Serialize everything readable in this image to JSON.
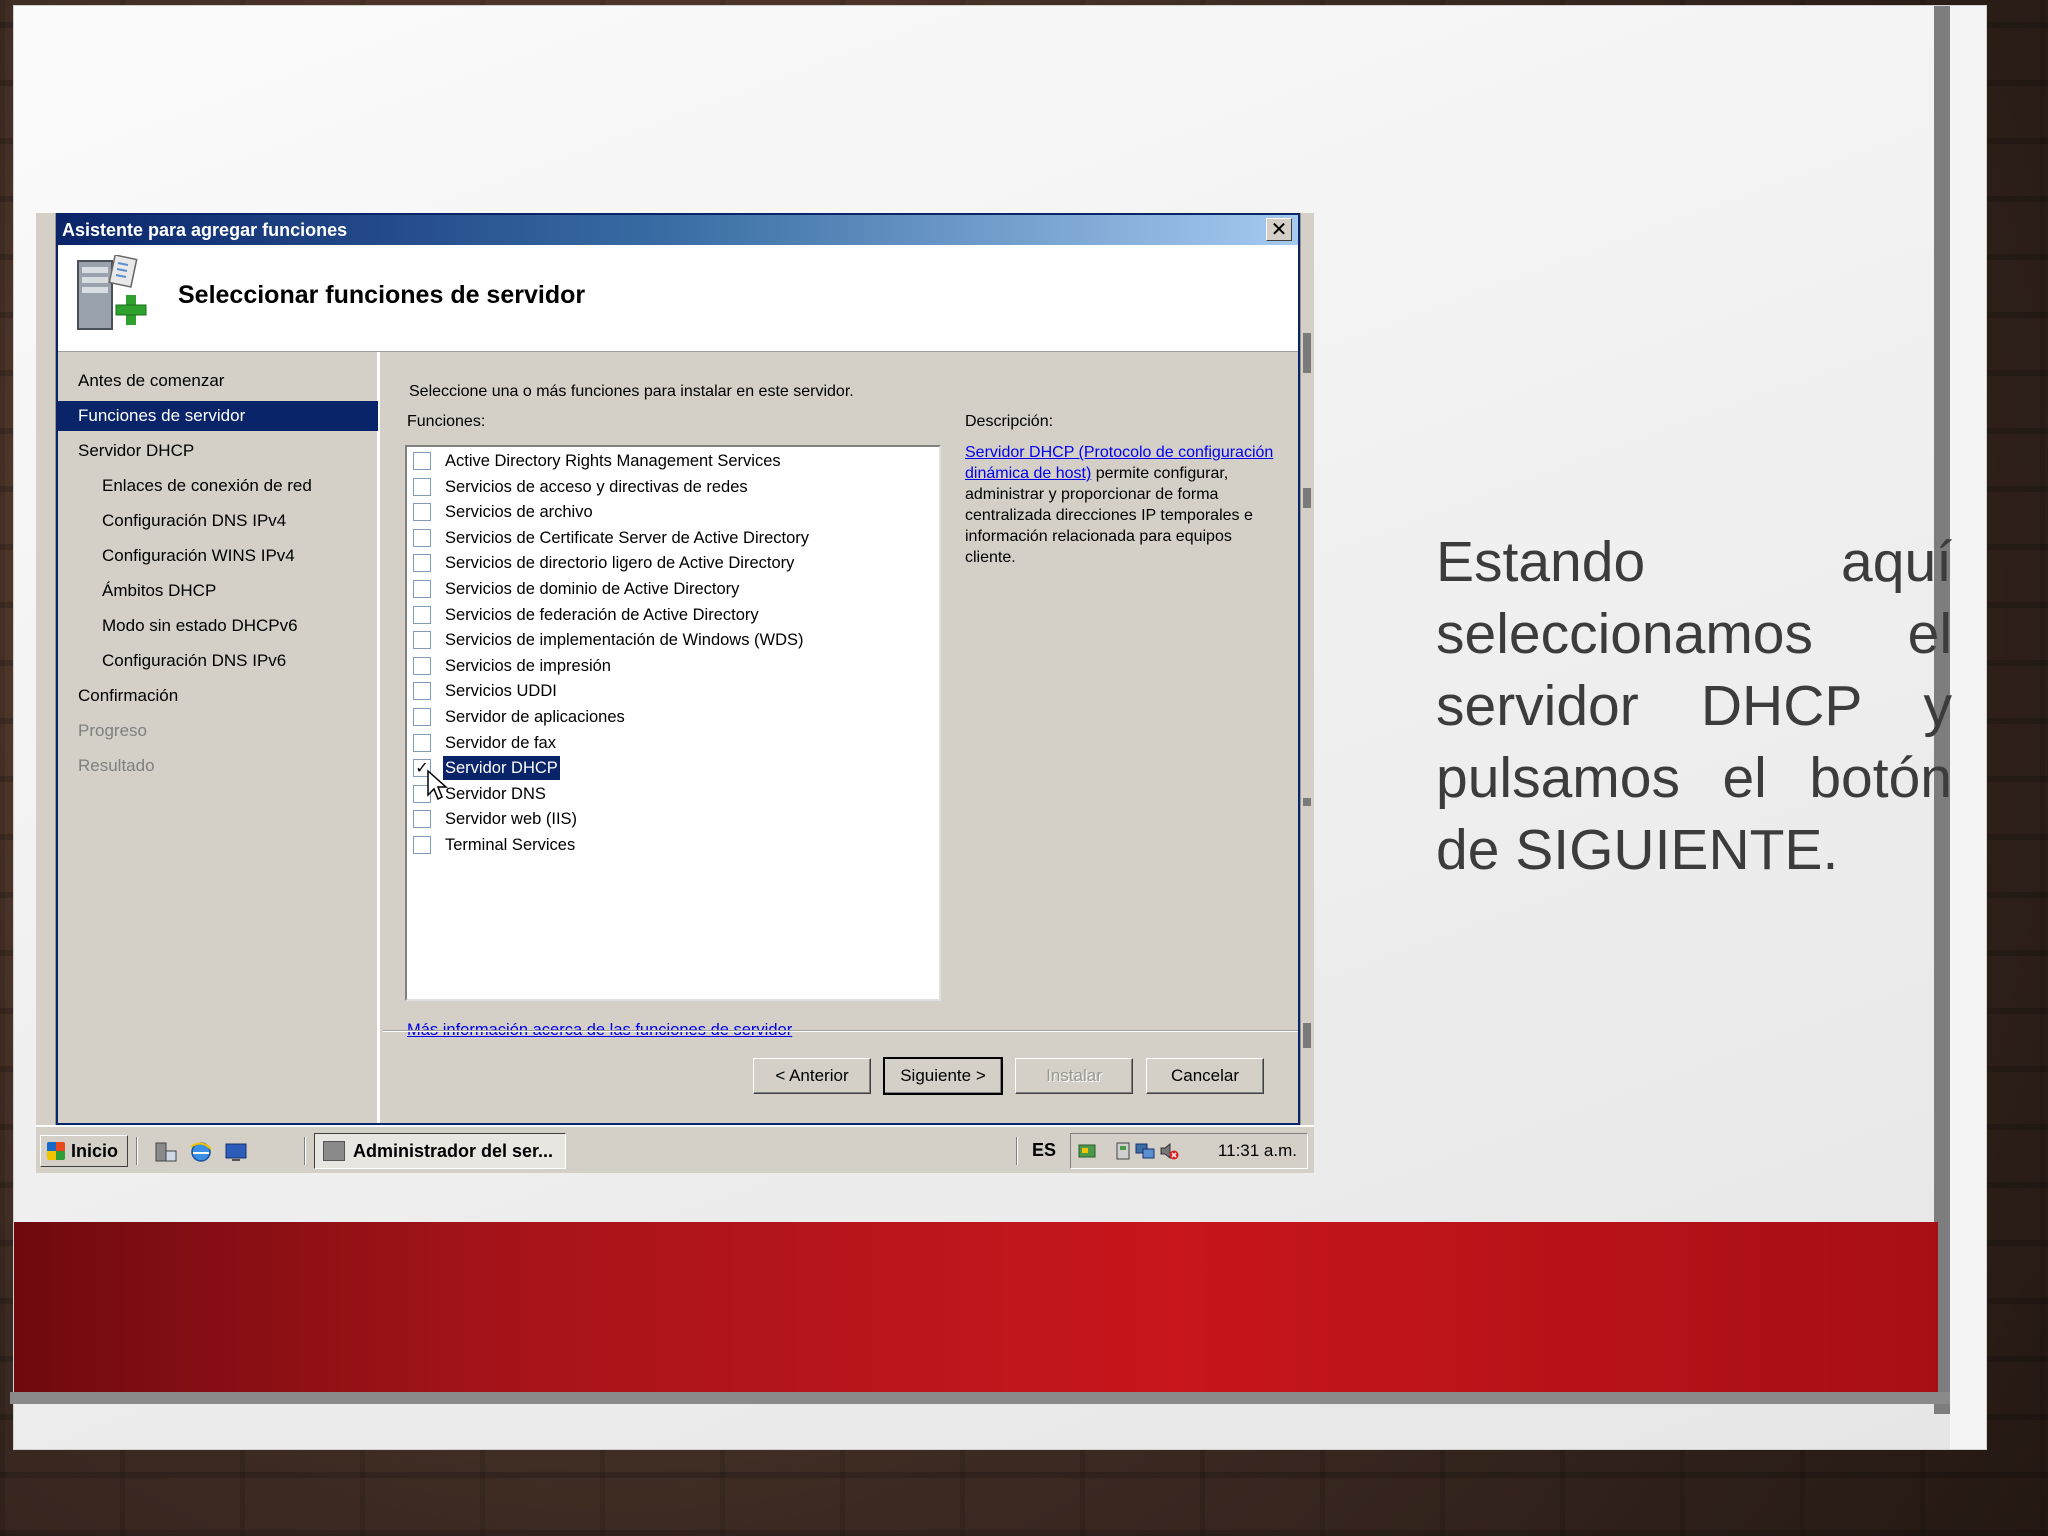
{
  "slide": {
    "text": "Estando aquí seleccionamos el servidor DHCP y pulsamos el botón de SIGUIENTE."
  },
  "dialog": {
    "title": "Asistente para agregar funciones",
    "close_label": "✕",
    "header_title": "Seleccionar funciones de servidor",
    "nav": [
      {
        "label": "Antes de comenzar",
        "state": "normal"
      },
      {
        "label": "Funciones de servidor",
        "state": "selected"
      },
      {
        "label": "Servidor DHCP",
        "state": "normal"
      },
      {
        "label": "Enlaces de conexión de red",
        "state": "sub"
      },
      {
        "label": "Configuración DNS IPv4",
        "state": "sub"
      },
      {
        "label": "Configuración WINS IPv4",
        "state": "sub"
      },
      {
        "label": "Ámbitos DHCP",
        "state": "sub"
      },
      {
        "label": "Modo sin estado DHCPv6",
        "state": "sub"
      },
      {
        "label": "Configuración DNS IPv6",
        "state": "sub"
      },
      {
        "label": "Confirmación",
        "state": "normal"
      },
      {
        "label": "Progreso",
        "state": "disabled"
      },
      {
        "label": "Resultado",
        "state": "disabled"
      }
    ],
    "instruction": "Seleccione una o más funciones para instalar en este servidor.",
    "roles_label": "Funciones:",
    "roles": [
      {
        "label": "Active Directory Rights Management Services",
        "checked": false
      },
      {
        "label": "Servicios de acceso y directivas de redes",
        "checked": false
      },
      {
        "label": "Servicios de archivo",
        "checked": false
      },
      {
        "label": "Servicios de Certificate Server de Active Directory",
        "checked": false
      },
      {
        "label": "Servicios de directorio ligero de Active Directory",
        "checked": false
      },
      {
        "label": "Servicios de dominio de Active Directory",
        "checked": false
      },
      {
        "label": "Servicios de federación de Active Directory",
        "checked": false
      },
      {
        "label": "Servicios de implementación de Windows (WDS)",
        "checked": false
      },
      {
        "label": "Servicios de impresión",
        "checked": false
      },
      {
        "label": "Servicios UDDI",
        "checked": false
      },
      {
        "label": "Servidor de aplicaciones",
        "checked": false
      },
      {
        "label": "Servidor de fax",
        "checked": false
      },
      {
        "label": "Servidor DHCP",
        "checked": true,
        "selected": true
      },
      {
        "label": "Servidor DNS",
        "checked": false
      },
      {
        "label": "Servidor web (IIS)",
        "checked": false
      },
      {
        "label": "Terminal Services",
        "checked": false
      }
    ],
    "description_label": "Descripción:",
    "description_link": "Servidor DHCP (Protocolo de configuración dinámica de host)",
    "description_text": " permite configurar, administrar y proporcionar de forma centralizada direcciones IP temporales e información relacionada para equipos cliente.",
    "more_info_link": "Más información acerca de las funciones de servidor",
    "buttons": {
      "back": "< Anterior",
      "next": "Siguiente >",
      "install": "Instalar",
      "cancel": "Cancelar"
    }
  },
  "taskbar": {
    "start_label": "Inicio",
    "task_label": "Administrador del ser...",
    "language": "ES",
    "clock": "11:31 a.m."
  }
}
